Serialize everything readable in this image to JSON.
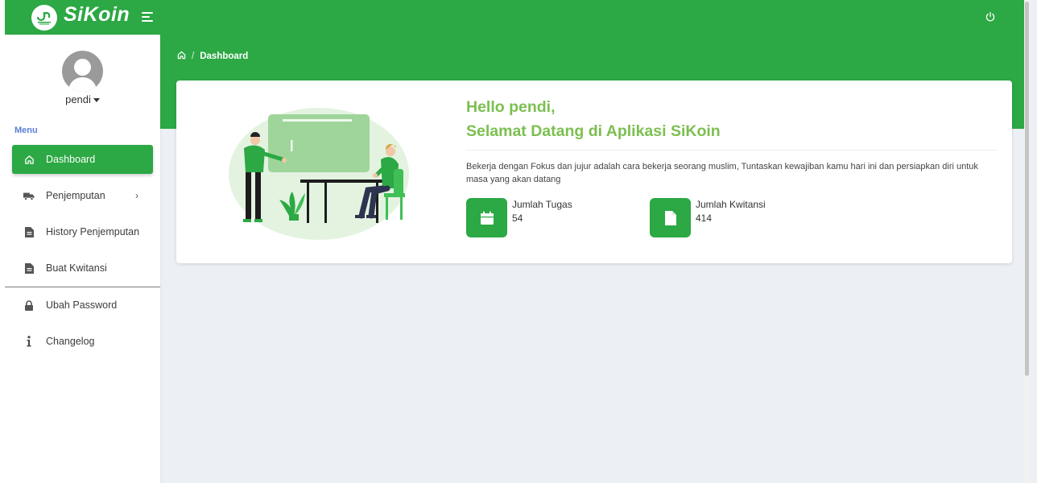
{
  "app": {
    "title": "SiKoin",
    "brand_color": "#2ca844",
    "accent_text_color": "#7cbf50"
  },
  "topbar": {
    "menu_toggle_icon": "hamburger-icon",
    "logout_icon": "power-icon"
  },
  "sidebar": {
    "username": "pendi",
    "menu_header": "Menu",
    "items": [
      {
        "label": "Dashboard",
        "icon": "home-icon",
        "active": true
      },
      {
        "label": "Penjemputan",
        "icon": "truck-icon",
        "has_children": true
      },
      {
        "label": "History Penjemputan",
        "icon": "document-icon"
      },
      {
        "label": "Buat Kwitansi",
        "icon": "document-icon"
      },
      {
        "label": "Ubah Password",
        "icon": "lock-icon"
      },
      {
        "label": "Changelog",
        "icon": "info-icon"
      }
    ]
  },
  "breadcrumb": {
    "separator": "/",
    "current": "Dashboard"
  },
  "welcome": {
    "greeting": "Hello pendi,",
    "subtitle": "Selamat Datang di Aplikasi SiKoin",
    "quote": "Bekerja dengan Fokus dan jujur adalah cara bekerja seorang muslim, Tuntaskan kewajiban kamu hari ini dan persiapkan diri untuk masa yang akan datang"
  },
  "stats": [
    {
      "label": "Jumlah Tugas",
      "value": "54",
      "icon": "calendar-icon"
    },
    {
      "label": "Jumlah Kwitansi",
      "value": "414",
      "icon": "file-icon"
    }
  ]
}
